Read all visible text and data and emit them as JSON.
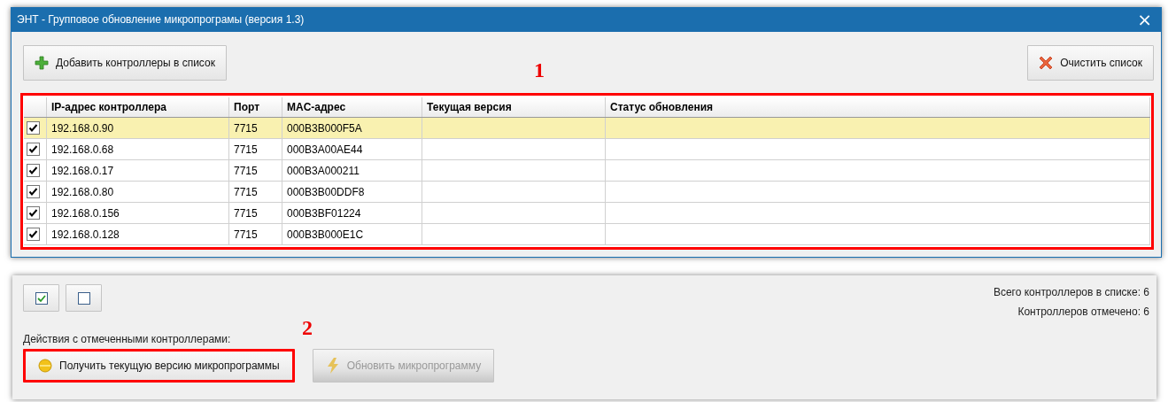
{
  "window": {
    "title": "ЭНТ - Групповое обновление микропрограмы (версия 1.3)",
    "close": "×"
  },
  "toolbar": {
    "add_button": "Добавить контроллеры в список",
    "clear_button": "Очистить список"
  },
  "table": {
    "callout": "1",
    "columns": [
      "IP-адрес контроллера",
      "Порт",
      "MAC-адрес",
      "Текущая версия",
      "Статус обновления"
    ],
    "rows": [
      {
        "checked": true,
        "selected": true,
        "ip": "192.168.0.90",
        "port": "7715",
        "mac": "000B3B000F5A"
      },
      {
        "checked": true,
        "selected": false,
        "ip": "192.168.0.68",
        "port": "7715",
        "mac": "000B3A00AE44"
      },
      {
        "checked": true,
        "selected": false,
        "ip": "192.168.0.17",
        "port": "7715",
        "mac": "000B3A000211"
      },
      {
        "checked": true,
        "selected": false,
        "ip": "192.168.0.80",
        "port": "7715",
        "mac": "000B3B00DDF8"
      },
      {
        "checked": true,
        "selected": false,
        "ip": "192.168.0.156",
        "port": "7715",
        "mac": "000B3BF01224"
      },
      {
        "checked": true,
        "selected": false,
        "ip": "192.168.0.128",
        "port": "7715",
        "mac": "000B3B000E1C"
      }
    ]
  },
  "bottom": {
    "actions_label": "Действия с отмеченными контроллерами:",
    "total": "Всего контроллеров в списке: 6",
    "checked_count": "Контроллеров отмечено: 6",
    "buttons": [
      {
        "kind": "get-version",
        "label": "Получить текущую версию микропрограммы",
        "disabled": false,
        "callout": "2"
      },
      {
        "kind": "update",
        "label": "Обновить микропрограмму",
        "disabled": true
      }
    ]
  }
}
